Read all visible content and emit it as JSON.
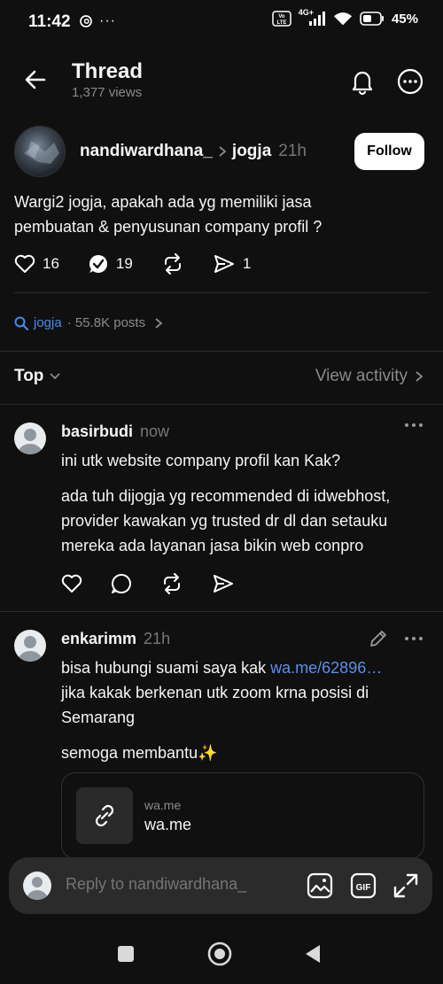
{
  "status_bar": {
    "time": "11:42",
    "battery": "45%",
    "network": "4G+"
  },
  "header": {
    "title": "Thread",
    "views": "1,377 views",
    "icons": [
      "back-arrow-icon",
      "bell-icon",
      "more-icon"
    ]
  },
  "post": {
    "author": "nandiwardhana_",
    "topic": "jogja",
    "age": "21h",
    "follow_label": "Follow",
    "text_line1": "Wargi2 jogja, apakah ada yg memiliki jasa",
    "text_line2": "pembuatan & penyusunan company profil ?",
    "likes": "16",
    "replies": "19",
    "shares": "1"
  },
  "topic_bar": {
    "topic": "jogja",
    "posts": "· 55.8K posts"
  },
  "sort": {
    "label": "Top",
    "view_activity": "View activity"
  },
  "replies": [
    {
      "author": "basirbudi",
      "age": "now",
      "lines": [
        "ini utk website company profil kan Kak?",
        "ada tuh dijogja yg recommended di idwebhost,",
        "provider kawakan yg trusted dr dl dan setauku",
        "mereka ada layanan jasa bikin web conpro"
      ]
    },
    {
      "author": "enkarimm",
      "age": "21h",
      "line1_prefix": "bisa hubungi suami saya kak ",
      "line1_link": "wa.me/62896…",
      "line2": "jika kakak berkenan utk zoom krna posisi di",
      "line3": "Semarang",
      "line4": "semoga membantu✨",
      "link_card": {
        "domain": "wa.me",
        "title": "wa.me"
      }
    }
  ],
  "composer": {
    "placeholder": "Reply to nandiwardhana_"
  },
  "colors": {
    "background": "#101010",
    "text": "#f3f5f7",
    "muted": "#777777",
    "link": "#4a8bea",
    "follow_bg": "#ffffff"
  }
}
